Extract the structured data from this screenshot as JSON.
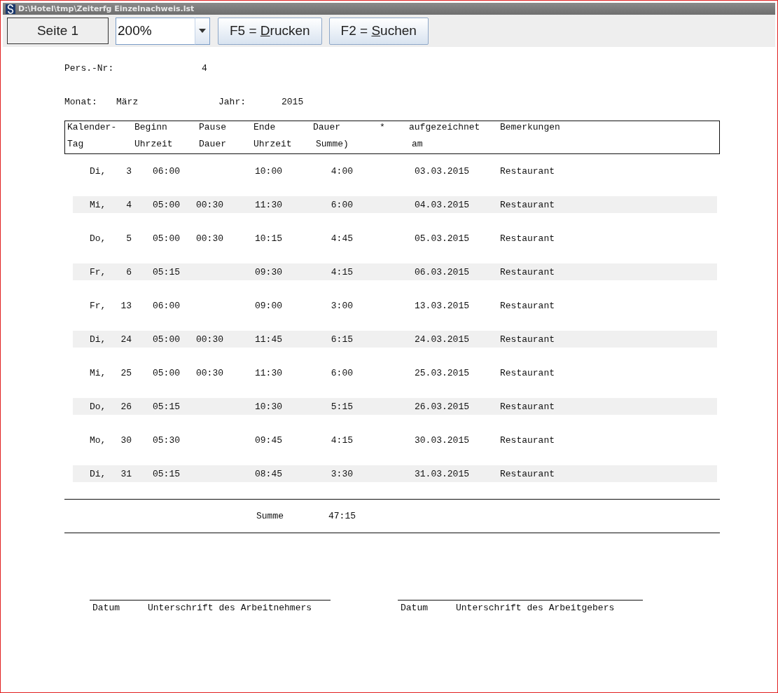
{
  "window": {
    "title": "D:\\Hotel\\tmp\\Zeiterfg Einzelnachweis.lst"
  },
  "toolbar": {
    "page_button": "Seite 1",
    "zoom": {
      "value": "200%"
    },
    "buttons": [
      {
        "prefix": "F5 = ",
        "mnemonic": "D",
        "suffix": "rucken"
      },
      {
        "prefix": "F2 = ",
        "mnemonic": "S",
        "suffix": "uchen"
      }
    ]
  },
  "report": {
    "person": {
      "label": "Pers.-Nr:",
      "value": "4"
    },
    "period": {
      "month_label": "Monat:",
      "month": "März",
      "year_label": "Jahr:",
      "year": "2015"
    },
    "columns": [
      {
        "line_1": "Kalender-",
        "line_2": "Tag"
      },
      {
        "line_1": "Beginn",
        "line_2": "Uhrzeit"
      },
      {
        "line_1": "Pause",
        "line_2": "Dauer"
      },
      {
        "line_1": "Ende",
        "line_2": "Uhrzeit"
      },
      {
        "line_1": "Dauer",
        "line_2": "Summe)"
      },
      {
        "line_1": "*"
      },
      {
        "line_1": "aufgezeichnet",
        "line_2": "am"
      },
      {
        "line_1": "Bemerkungen"
      }
    ],
    "rows": [
      {
        "weekday": "Di,",
        "day": "3",
        "begin": "06:00",
        "end": "10:00",
        "duration": "4:00",
        "recorded": "03.03.2015",
        "remark": "Restaurant"
      },
      {
        "weekday": "Mi,",
        "day": "4",
        "begin": "05:00",
        "pause": "00:30",
        "end": "11:30",
        "duration": "6:00",
        "recorded": "04.03.2015",
        "remark": "Restaurant"
      },
      {
        "weekday": "Do,",
        "day": "5",
        "begin": "05:00",
        "pause": "00:30",
        "end": "10:15",
        "duration": "4:45",
        "recorded": "05.03.2015",
        "remark": "Restaurant"
      },
      {
        "weekday": "Fr,",
        "day": "6",
        "begin": "05:15",
        "end": "09:30",
        "duration": "4:15",
        "recorded": "06.03.2015",
        "remark": "Restaurant"
      },
      {
        "weekday": "Fr,",
        "day": "13",
        "begin": "06:00",
        "end": "09:00",
        "duration": "3:00",
        "recorded": "13.03.2015",
        "remark": "Restaurant"
      },
      {
        "weekday": "Di,",
        "day": "24",
        "begin": "05:00",
        "pause": "00:30",
        "end": "11:45",
        "duration": "6:15",
        "recorded": "24.03.2015",
        "remark": "Restaurant"
      },
      {
        "weekday": "Mi,",
        "day": "25",
        "begin": "05:00",
        "pause": "00:30",
        "end": "11:30",
        "duration": "6:00",
        "recorded": "25.03.2015",
        "remark": "Restaurant"
      },
      {
        "weekday": "Do,",
        "day": "26",
        "begin": "05:15",
        "end": "10:30",
        "duration": "5:15",
        "recorded": "26.03.2015",
        "remark": "Restaurant"
      },
      {
        "weekday": "Mo,",
        "day": "30",
        "begin": "05:30",
        "end": "09:45",
        "duration": "4:15",
        "recorded": "30.03.2015",
        "remark": "Restaurant"
      },
      {
        "weekday": "Di,",
        "day": "31",
        "begin": "05:15",
        "end": "08:45",
        "duration": "3:30",
        "recorded": "31.03.2015",
        "remark": "Restaurant"
      }
    ],
    "total": {
      "label": "Summe",
      "value": "47:15"
    },
    "signatures": [
      {
        "date_label": "Datum",
        "caption": "Unterschrift des Arbeitnehmers"
      },
      {
        "date_label": "Datum",
        "caption": "Unterschrift des Arbeitgebers"
      }
    ]
  }
}
